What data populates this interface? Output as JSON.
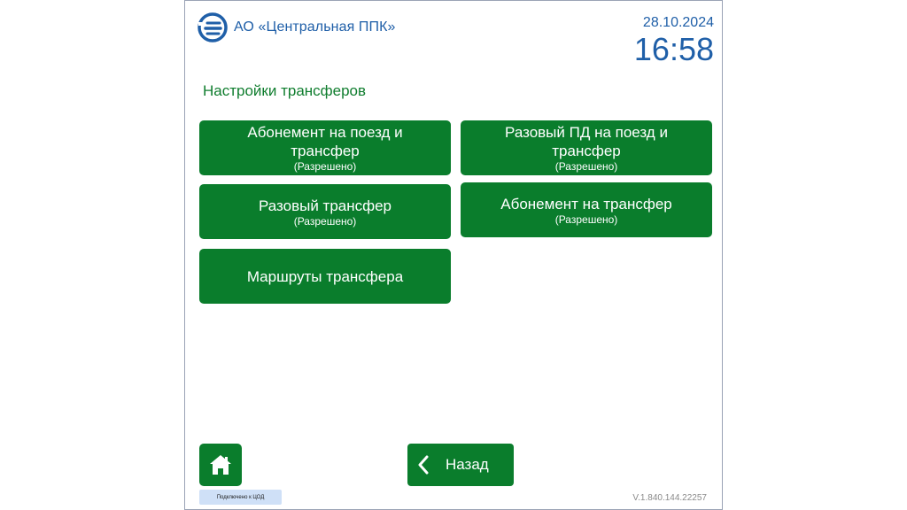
{
  "header": {
    "company": "АО «Центральная ППК»",
    "date": "28.10.2024",
    "time": "16:58"
  },
  "page_title": "Настройки трансферов",
  "tiles": [
    {
      "title": "Абонемент на поезд и трансфер",
      "status": "(Разрешено)"
    },
    {
      "title": "Разовый ПД на поезд и трансфер",
      "status": "(Разрешено)"
    },
    {
      "title": "Разовый трансфер",
      "status": "(Разрешено)"
    },
    {
      "title": "Абонемент на трансфер",
      "status": "(Разрешено)"
    },
    {
      "title": "Маршруты трансфера"
    }
  ],
  "footer": {
    "back_label": "Назад",
    "connection_status": "Подключено к ЦОД",
    "version": "V.1.840.144.22257"
  },
  "colors": {
    "brand_blue": "#1f5fa8",
    "tile_green": "#0a7d2c",
    "title_green": "#0f7d2e",
    "status_chip": "#cfe0f7"
  },
  "icons": {
    "logo": "ppk-logo-icon",
    "home": "home-icon",
    "back": "chevron-left-icon"
  }
}
